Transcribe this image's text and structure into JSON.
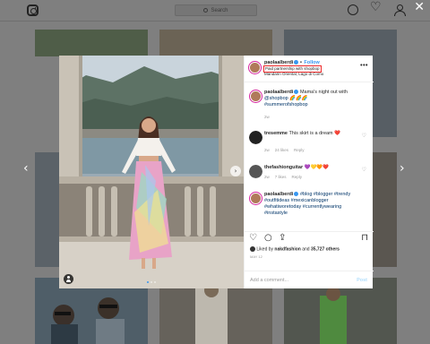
{
  "header": {
    "search_placeholder": "Search",
    "logo_icon": "instagram-camera-icon",
    "icons": [
      "compass-icon",
      "heart-icon",
      "profile-icon"
    ]
  },
  "post": {
    "username": "paolaalberdi",
    "follow_label": "Follow",
    "paid_label": "Paid partnership with shopbop",
    "location": "Mandarin Oriental, Lago di Como",
    "more_label": "•••",
    "caption": {
      "username": "paolaalberdi",
      "text": "Mama's night out with",
      "mention": "@shopbop",
      "emoji": "🌈🌈🌈",
      "hashtag": "#summerofshopbop",
      "time": "2w"
    },
    "comments": [
      {
        "username": "tresemme",
        "text": "This skirt is a dream ❤️",
        "time": "2w",
        "likes": "24 likes",
        "reply": "Reply"
      },
      {
        "username": "thefashionguitar",
        "text": "💜💛🧡❤️",
        "time": "2w",
        "likes": "7 likes",
        "reply": "Reply"
      },
      {
        "username": "paolaalberdi",
        "text": "#blog #blogger #trendy #outfitideas #mexicanblogger #whatiworetoday #currentlywearing #instastyle",
        "time": "2w",
        "likes": "",
        "reply": ""
      }
    ],
    "liked_by_prefix": "Liked by",
    "liked_by_user": "nakdfashion",
    "liked_by_mid": "and",
    "liked_by_count": "35,727 others",
    "date": "MAY 12",
    "add_comment_placeholder": "Add a comment...",
    "post_label": "Post"
  },
  "colors": {
    "accent_blue": "#3897f0",
    "paid_box_red": "#ed2b2b",
    "overlay_gray": "#7f7f7f"
  }
}
